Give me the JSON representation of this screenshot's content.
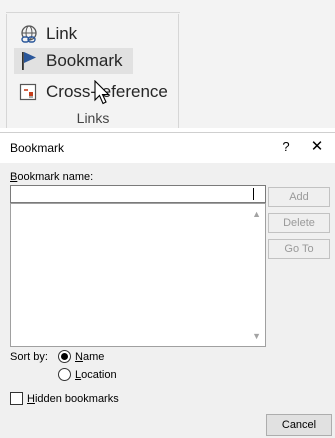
{
  "ribbon": {
    "items": [
      {
        "label": "Link",
        "icon": "link-icon"
      },
      {
        "label": "Bookmark",
        "icon": "bookmark-flag-icon"
      },
      {
        "label": "Cross-reference",
        "icon": "cross-reference-icon"
      }
    ],
    "group_label": "Links"
  },
  "dialog": {
    "title": "Bookmark",
    "help": "?",
    "close": "✕",
    "name_label_u": "B",
    "name_label_rest": "ookmark name:",
    "name_value": "",
    "buttons": {
      "add": "Add",
      "delete": "Delete",
      "goto": "Go To",
      "cancel": "Cancel"
    },
    "sort_by_label": "Sort by:",
    "sort_options": [
      {
        "u": "N",
        "rest": "ame",
        "checked": true
      },
      {
        "u": "L",
        "rest": "ocation",
        "checked": false
      }
    ],
    "hidden_u": "H",
    "hidden_rest": "idden bookmarks",
    "hidden_checked": false
  },
  "colors": {
    "bookmark_flag": "#2b579a",
    "ribbon_bg": "#f3f3f3",
    "dialog_bg": "#f0f0f0"
  }
}
